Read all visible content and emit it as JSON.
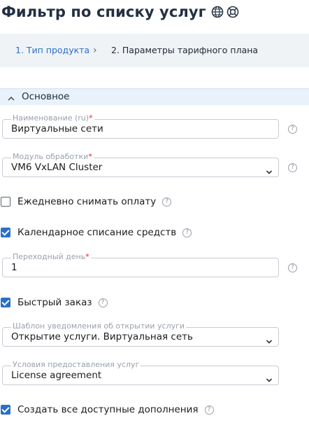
{
  "page": {
    "title": "Фильтр по списку услуг"
  },
  "breadcrumb": {
    "step1": "1. Тип продукта",
    "separator": "›",
    "step2": "2. Параметры тарифного плана"
  },
  "section": {
    "title": "Основное",
    "expanded": true
  },
  "fields": {
    "name": {
      "label": "Наименование (ru)",
      "required": "*",
      "value": "Виртуальные сети"
    },
    "module": {
      "label": "Модуль обработки",
      "required": "*",
      "value": "VM6 VxLAN Cluster"
    },
    "transition_day": {
      "label": "Переходный день",
      "required": "*",
      "value": "1"
    },
    "notify_template": {
      "label": "Шаблон уведомления об открытии услуги",
      "value": "Открытие услуги. Виртуальная сеть"
    },
    "terms": {
      "label": "Условия предоставления услуг",
      "value": "License agreement"
    }
  },
  "checkboxes": {
    "daily_charge": {
      "label": "Ежедневно снимать оплату",
      "checked": false
    },
    "calendar_charge": {
      "label": "Календарное списание средств",
      "checked": true
    },
    "quick_order": {
      "label": "Быстрый заказ",
      "checked": true
    },
    "create_addons": {
      "label": "Создать все доступные дополнения",
      "checked": true
    }
  },
  "help_glyph": "?",
  "colors": {
    "accent": "#2a70c9",
    "required": "#e0252a",
    "section_bg": "#e9f1fb",
    "breadcrumb_bg": "#f0f3f6"
  }
}
